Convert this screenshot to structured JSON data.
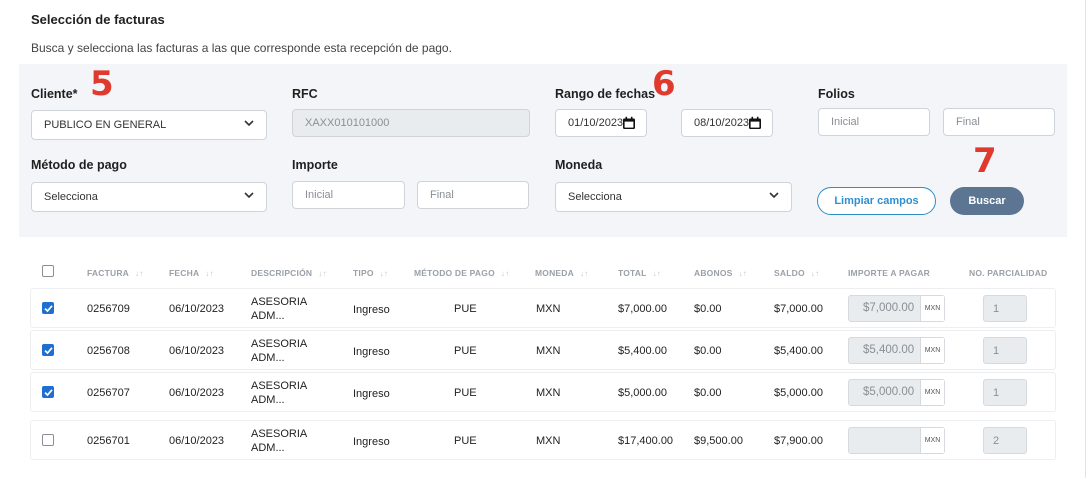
{
  "section": {
    "title": "Selección de facturas",
    "subtitle": "Busca y selecciona las facturas a las que corresponde esta recepción de pago."
  },
  "filters": {
    "client": {
      "label": "Cliente*",
      "value": "PUBLICO EN GENERAL"
    },
    "rfc": {
      "label": "RFC",
      "value": "XAXX010101000"
    },
    "date_range": {
      "label": "Rango de fechas",
      "from": "01/10/2023",
      "to": "08/10/2023"
    },
    "folios": {
      "label": "Folios",
      "from_placeholder": "Inicial",
      "to_placeholder": "Final"
    },
    "payment_method": {
      "label": "Método de pago",
      "value": "Selecciona"
    },
    "amount": {
      "label": "Importe",
      "from_placeholder": "Inicial",
      "to_placeholder": "Final"
    },
    "currency": {
      "label": "Moneda",
      "value": "Selecciona"
    },
    "clear_button": "Limpiar campos",
    "search_button": "Buscar"
  },
  "annotations": {
    "client_marker": "5",
    "date_marker": "6",
    "search_marker": "7",
    "color": "#e03a2e"
  },
  "table": {
    "headers": {
      "factura": "FACTURA",
      "fecha": "FECHA",
      "descripcion": "DESCRIPCIÓN",
      "tipo": "TIPO",
      "metodo": "MÉTODO DE PAGO",
      "moneda": "MONEDA",
      "total": "TOTAL",
      "abonos": "ABONOS",
      "saldo": "SALDO",
      "importe": "IMPORTE A PAGAR",
      "parcialidad": "NO. PARCIALIDAD"
    },
    "sort_glyph": "↓↑",
    "rows": [
      {
        "checked": true,
        "factura": "0256709",
        "fecha": "06/10/2023",
        "desc1": "ASESORIA",
        "desc2": "ADM...",
        "tipo": "Ingreso",
        "metodo": "PUE",
        "moneda": "MXN",
        "total": "$7,000.00",
        "abonos": "$0.00",
        "saldo": "$7,000.00",
        "importe": "$7,000.00",
        "importe_currency": "MXN",
        "parcialidad": "1"
      },
      {
        "checked": true,
        "factura": "0256708",
        "fecha": "06/10/2023",
        "desc1": "ASESORIA",
        "desc2": "ADM...",
        "tipo": "Ingreso",
        "metodo": "PUE",
        "moneda": "MXN",
        "total": "$5,400.00",
        "abonos": "$0.00",
        "saldo": "$5,400.00",
        "importe": "$5,400.00",
        "importe_currency": "MXN",
        "parcialidad": "1"
      },
      {
        "checked": true,
        "factura": "0256707",
        "fecha": "06/10/2023",
        "desc1": "ASESORIA",
        "desc2": "ADM...",
        "tipo": "Ingreso",
        "metodo": "PUE",
        "moneda": "MXN",
        "total": "$5,000.00",
        "abonos": "$0.00",
        "saldo": "$5,000.00",
        "importe": "$5,000.00",
        "importe_currency": "MXN",
        "parcialidad": "1"
      },
      {
        "checked": false,
        "factura": "0256701",
        "fecha": "06/10/2023",
        "desc1": "ASESORIA",
        "desc2": "ADM...",
        "tipo": "Ingreso",
        "metodo": "PUE",
        "moneda": "MXN",
        "total": "$17,400.00",
        "abonos": "$9,500.00",
        "saldo": "$7,900.00",
        "importe": "",
        "importe_currency": "MXN",
        "parcialidad": "2"
      }
    ]
  },
  "colors": {
    "accent": "#2f8fd0",
    "primary_button": "#5c7592",
    "checkbox": "#1f6fd1",
    "panel": "#f3f5f8"
  }
}
